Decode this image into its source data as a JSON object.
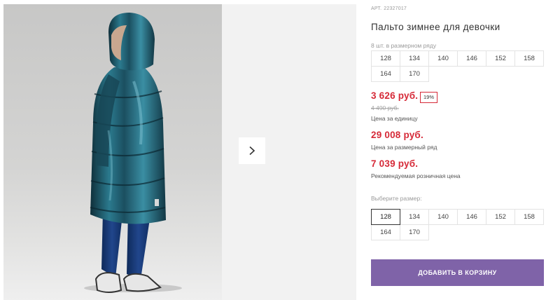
{
  "product": {
    "sku_label": "АРТ.",
    "sku_number": "22327017",
    "title": "Пальто зимнее для девочки",
    "row_count_text": "8 шт. в размерном ряду",
    "row_sizes": [
      "128",
      "134",
      "140",
      "146",
      "152",
      "158",
      "164",
      "170"
    ]
  },
  "gallery": {
    "main_photo_icon": "girl-in-metallic-blue-puffer-coat",
    "next_icon": "chevron-right-icon"
  },
  "pricing": {
    "unit_price": "3 626 руб.",
    "discount": "19%",
    "old_price": "4 490 руб.",
    "unit_caption": "Цена за единицу",
    "row_price": "29 008 руб.",
    "row_caption": "Цена за размерный ряд",
    "retail_price": "7 039 руб.",
    "retail_caption": "Рекомендуемая розничная цена"
  },
  "size_select": {
    "label": "Выберите размер:",
    "selected": "128",
    "sizes": [
      "128",
      "134",
      "140",
      "146",
      "152",
      "158",
      "164",
      "170"
    ]
  },
  "cart": {
    "add_label": "ДОБАВИТЬ В КОРЗИНУ"
  },
  "colors": {
    "price": "#d62a38",
    "button": "#7f63a8",
    "coat": "#1f5566"
  }
}
